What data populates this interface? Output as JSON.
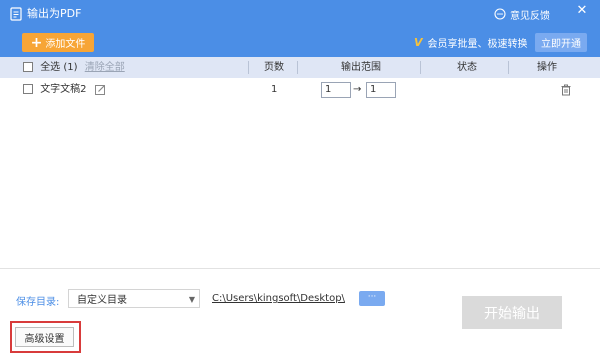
{
  "window": {
    "title": "输出为PDF",
    "feedback": "意见反馈",
    "close_icon": "close-icon",
    "app_icon": "pdf-export-icon"
  },
  "toolbar": {
    "add_file": "添加文件",
    "vip_badge": "V",
    "vip_text": "会员享批量、极速转换",
    "open_now": "立即开通"
  },
  "table": {
    "select_all": "全选 (1)",
    "clear_all": "清除全部",
    "headers": {
      "pages": "页数",
      "range": "输出范围",
      "status": "状态",
      "actions": "操作"
    },
    "rows": [
      {
        "name": "文字文稿2",
        "pages": "1",
        "range_from": "1",
        "range_arrow": "→",
        "range_to": "1",
        "status": ""
      }
    ]
  },
  "footer": {
    "save_dir_label": "保存目录:",
    "save_dir_option": "自定义目录",
    "save_path": "C:\\Users\\kingsoft\\Desktop\\",
    "more_label": "···",
    "start_output": "开始输出",
    "advanced_settings": "高级设置"
  },
  "colors": {
    "header_bg": "#4b8ee6",
    "add_button": "#f7a536",
    "table_header_bg": "#dfe6f5",
    "highlight_border": "#d83b3b",
    "disabled_button": "#dadada"
  }
}
